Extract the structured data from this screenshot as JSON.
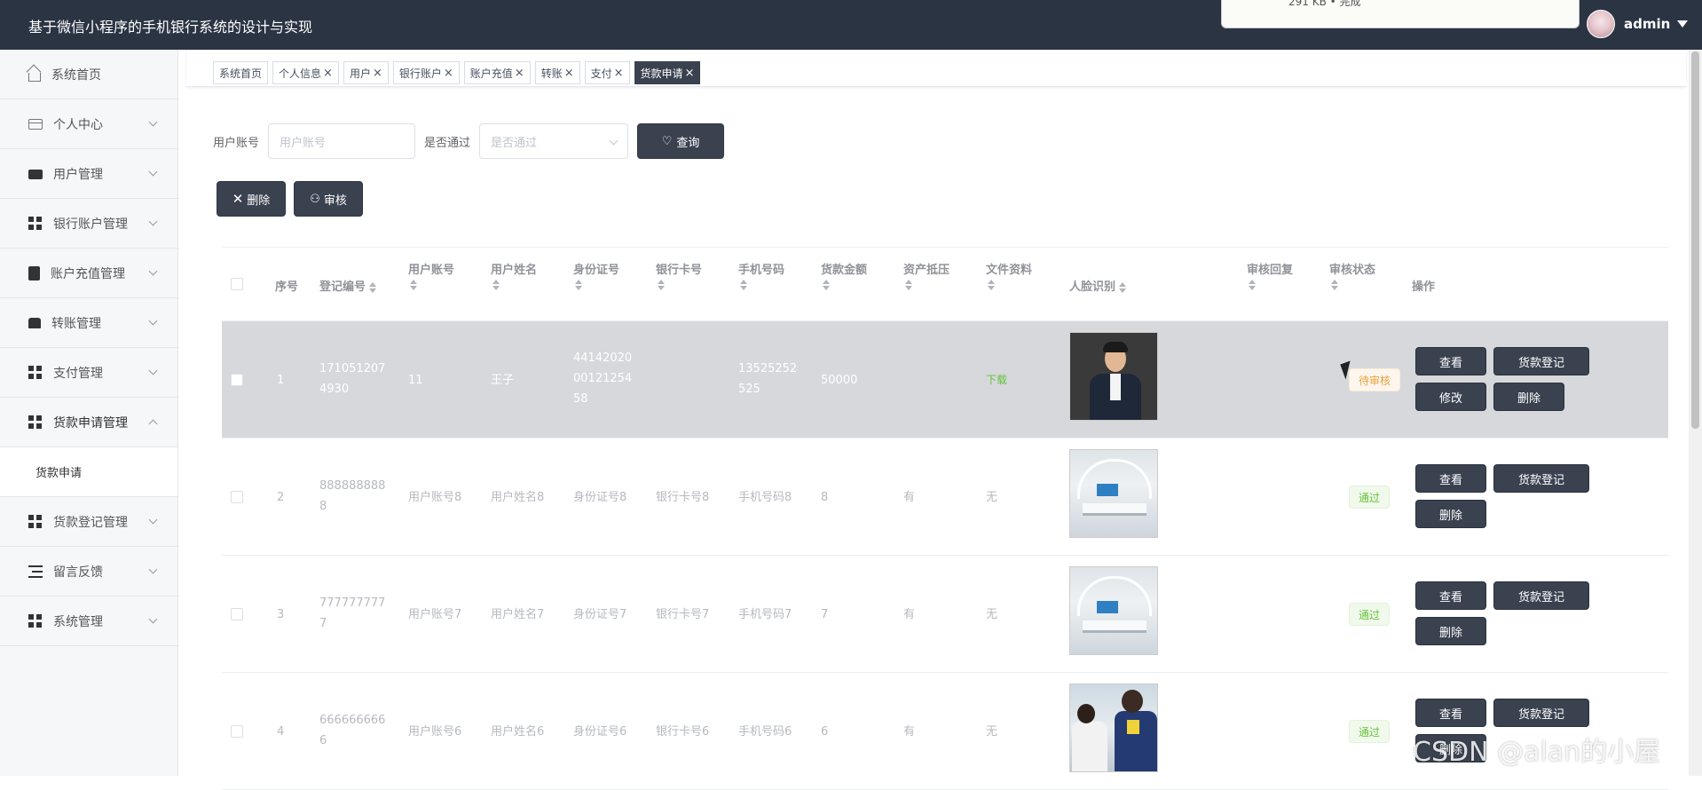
{
  "app": {
    "title": "基于微信小程序的手机银行系统的设计与实现"
  },
  "download_popup": {
    "text": "291 KB • 完成"
  },
  "user": {
    "name": "admin"
  },
  "sidebar": {
    "items": [
      {
        "label": "系统首页",
        "icon": "home-icon"
      },
      {
        "label": "个人中心",
        "icon": "card-icon"
      },
      {
        "label": "用户管理",
        "icon": "ticket-icon"
      },
      {
        "label": "银行账户管理",
        "icon": "grid-icon"
      },
      {
        "label": "账户充值管理",
        "icon": "clipboard-icon"
      },
      {
        "label": "转账管理",
        "icon": "bus-icon"
      },
      {
        "label": "支付管理",
        "icon": "grid-icon"
      },
      {
        "label": "货款申请管理",
        "icon": "grid-icon"
      },
      {
        "label": "货款登记管理",
        "icon": "grid-icon"
      },
      {
        "label": "留言反馈",
        "icon": "list-icon"
      },
      {
        "label": "系统管理",
        "icon": "grid-icon"
      }
    ],
    "submenu": {
      "label": "货款申请"
    }
  },
  "tabs": [
    {
      "label": "系统首页"
    },
    {
      "label": "个人信息"
    },
    {
      "label": "用户"
    },
    {
      "label": "银行账户"
    },
    {
      "label": "账户充值"
    },
    {
      "label": "转账"
    },
    {
      "label": "支付"
    },
    {
      "label": "货款申请"
    }
  ],
  "search": {
    "account_label": "用户账号",
    "account_placeholder": "用户账号",
    "passed_label": "是否通过",
    "passed_placeholder": "是否通过",
    "query_label": "查询"
  },
  "actions": {
    "delete_label": "删除",
    "audit_label": "审核"
  },
  "table": {
    "headers": {
      "index": "序号",
      "reg_no": "登记编号",
      "account": "用户账号",
      "name": "用户姓名",
      "id_no": "身份证号",
      "card_no": "银行卡号",
      "phone": "手机号码",
      "amount": "货款金额",
      "collateral": "资产抵压",
      "files": "文件资料",
      "face": "人脸识别",
      "reply": "审核回复",
      "status": "审核状态",
      "ops": "操作"
    },
    "rows": [
      {
        "index": "1",
        "reg_no_a": "171051207",
        "reg_no_b": "4930",
        "account": "11",
        "name": "王子",
        "id_a": "44142020",
        "id_b": "00121254",
        "id_c": "58",
        "card": "",
        "phone_a": "13525252",
        "phone_b": "525",
        "amount": "50000",
        "collateral": "",
        "files": "下载",
        "status": "待审核",
        "buttons": [
          "查看",
          "货款登记",
          "修改",
          "删除"
        ]
      },
      {
        "index": "2",
        "reg_no_a": "888888888",
        "reg_no_b": "8",
        "account": "用户账号8",
        "name": "用户姓名8",
        "id": "身份证号8",
        "card": "银行卡号8",
        "phone": "手机号码8",
        "amount": "8",
        "collateral": "有",
        "files": "无",
        "status": "通过",
        "buttons": [
          "查看",
          "货款登记",
          "删除"
        ]
      },
      {
        "index": "3",
        "reg_no_a": "777777777",
        "reg_no_b": "7",
        "account": "用户账号7",
        "name": "用户姓名7",
        "id": "身份证号7",
        "card": "银行卡号7",
        "phone": "手机号码7",
        "amount": "7",
        "collateral": "有",
        "files": "无",
        "status": "通过",
        "buttons": [
          "查看",
          "货款登记",
          "删除"
        ]
      },
      {
        "index": "4",
        "reg_no_a": "666666666",
        "reg_no_b": "6",
        "account": "用户账号6",
        "name": "用户姓名6",
        "id": "身份证号6",
        "card": "银行卡号6",
        "phone": "手机号码6",
        "amount": "6",
        "collateral": "有",
        "files": "无",
        "status": "通过",
        "buttons": [
          "查看",
          "货款登记",
          "删除"
        ]
      }
    ]
  },
  "watermark": "CSDN @alan的小屋",
  "colors": {
    "topbar": "#2a3443",
    "button": "#3a4250",
    "success": "#67c23a",
    "warning": "#e6a23c"
  }
}
